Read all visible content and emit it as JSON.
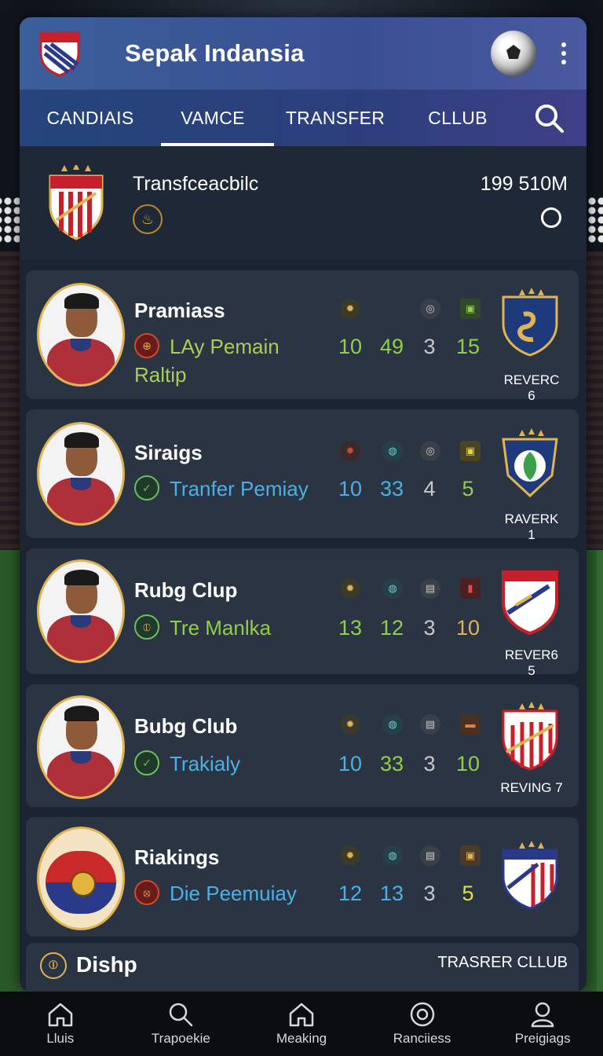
{
  "app": {
    "title": "Sepak Indansia"
  },
  "tabs": [
    {
      "label": "CANDIAIS"
    },
    {
      "label": "VAMCE",
      "active": true
    },
    {
      "label": "TRANSFER"
    },
    {
      "label": "CLLUB"
    }
  ],
  "featured": {
    "title": "Transfceacbilc",
    "value": "199 510M"
  },
  "players": [
    {
      "name": "Pramiass",
      "sub": "LAy Pemain",
      "sub2": "Raltip",
      "sub_color": "#a7cf55",
      "sub_icon_color": "#d04a2a",
      "stats": [
        "10",
        "49",
        "3",
        "15"
      ],
      "stat_colors": [
        "#8fcf4a",
        "#8fcf4a",
        "#c8c8c8",
        "#8fcf4a"
      ],
      "club_label": "REVERC 6"
    },
    {
      "name": "Siraigs",
      "sub": "Tranfer Pemiay",
      "sub_color": "#4ab0e6",
      "sub_icon_color": "#6ac05a",
      "stats": [
        "10",
        "33",
        "4",
        "5"
      ],
      "stat_colors": [
        "#4ab0e6",
        "#4ab0e6",
        "#c8c8c8",
        "#8fcf4a"
      ],
      "club_label": "RAVERK 1"
    },
    {
      "name": "Rubg Clup",
      "sub": "Tre Manlka",
      "sub_color": "#8fcf4a",
      "sub_icon_color": "#6ac05a",
      "stats": [
        "13",
        "12",
        "3",
        "10"
      ],
      "stat_colors": [
        "#8fcf4a",
        "#8fcf4a",
        "#c8c8c8",
        "#e0b453"
      ],
      "club_label": "REVER6 5"
    },
    {
      "name": "Bubg Club",
      "sub": "Trakialy",
      "sub_color": "#4ab0e6",
      "sub_icon_color": "#6ac05a",
      "stats": [
        "10",
        "33",
        "3",
        "10"
      ],
      "stat_colors": [
        "#4ab0e6",
        "#8fcf4a",
        "#c8c8c8",
        "#8fcf4a"
      ],
      "club_label": "REVING 7"
    },
    {
      "name": "Riakings",
      "sub": "Die Peemuiay",
      "sub_color": "#4ab0e6",
      "sub_icon_color": "#d04a2a",
      "stats": [
        "12",
        "13",
        "3",
        "5"
      ],
      "stat_colors": [
        "#4ab0e6",
        "#4ab0e6",
        "#c8c8c8",
        "#e0e04a"
      ],
      "club_label": ""
    }
  ],
  "footer_card": {
    "title": "Dishp",
    "action": "TRASRER CLLUB"
  },
  "bottom_nav": [
    {
      "label": "Lluis",
      "icon": "home-icon"
    },
    {
      "label": "Trapoekie",
      "icon": "search-icon"
    },
    {
      "label": "Meaking",
      "icon": "home-icon"
    },
    {
      "label": "Ranciiess",
      "icon": "target-icon"
    },
    {
      "label": "Preigiags",
      "icon": "profile-icon"
    }
  ]
}
